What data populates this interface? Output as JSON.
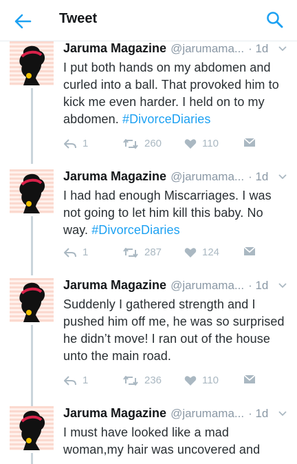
{
  "header": {
    "title": "Tweet"
  },
  "tweets": [
    {
      "author": "Jaruma Magazine",
      "handle": "@jarumama...",
      "time": "· 1d",
      "text": "I put both hands on my abdomen and curled into a ball. That provoked him to kick me even harder. I held on to my abdomen. ",
      "hashtag": "#DivorceDiaries",
      "replies": "1",
      "retweets": "260",
      "likes": "110"
    },
    {
      "author": "Jaruma Magazine",
      "handle": "@jarumama...",
      "time": "· 1d",
      "text": "I had had enough Miscarriages. I was not going to let him kill this baby. No way. ",
      "hashtag": "#DivorceDiaries",
      "replies": "1",
      "retweets": "287",
      "likes": "124"
    },
    {
      "author": "Jaruma Magazine",
      "handle": "@jarumama...",
      "time": "· 1d",
      "text": "Suddenly I gathered strength and I pushed him off me, he was so surprised he didn’t move! I ran out of the house unto the main road.",
      "hashtag": "",
      "replies": "1",
      "retweets": "236",
      "likes": "110"
    },
    {
      "author": "Jaruma Magazine",
      "handle": "@jarumama...",
      "time": "· 1d",
      "text": "I must have looked like a mad woman,my hair was uncovered and",
      "hashtag": "",
      "replies": "",
      "retweets": "",
      "likes": ""
    }
  ],
  "colors": {
    "accent": "#1da1f2",
    "muted": "#aab8c2",
    "text": "#292f33"
  },
  "icons": [
    "back-arrow-icon",
    "search-icon",
    "caret-down-icon",
    "reply-icon",
    "retweet-icon",
    "like-icon",
    "message-icon"
  ]
}
